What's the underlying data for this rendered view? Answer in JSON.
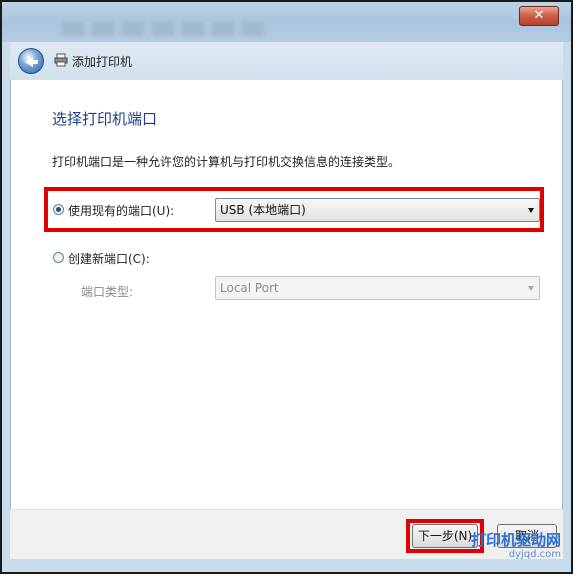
{
  "window": {
    "close_glyph": "✕"
  },
  "nav": {
    "back_icon": "back-arrow-icon",
    "title": "添加打印机"
  },
  "page": {
    "heading": "选择打印机端口",
    "description": "打印机端口是一种允许您的计算机与打印机交换信息的连接类型。"
  },
  "existing_port": {
    "radio_label": "使用现有的端口(U):",
    "selected": "USB (本地端口)",
    "checked": true
  },
  "new_port": {
    "radio_label": "创建新端口(C):",
    "type_label": "端口类型:",
    "selected": "Local Port",
    "checked": false
  },
  "buttons": {
    "next": "下一步(N)",
    "cancel": "取消"
  },
  "watermark": {
    "name": "打印机驱动网",
    "url": "dyjqd.com"
  },
  "colors": {
    "highlight": "#e10000",
    "heading": "#1e3f8a"
  }
}
